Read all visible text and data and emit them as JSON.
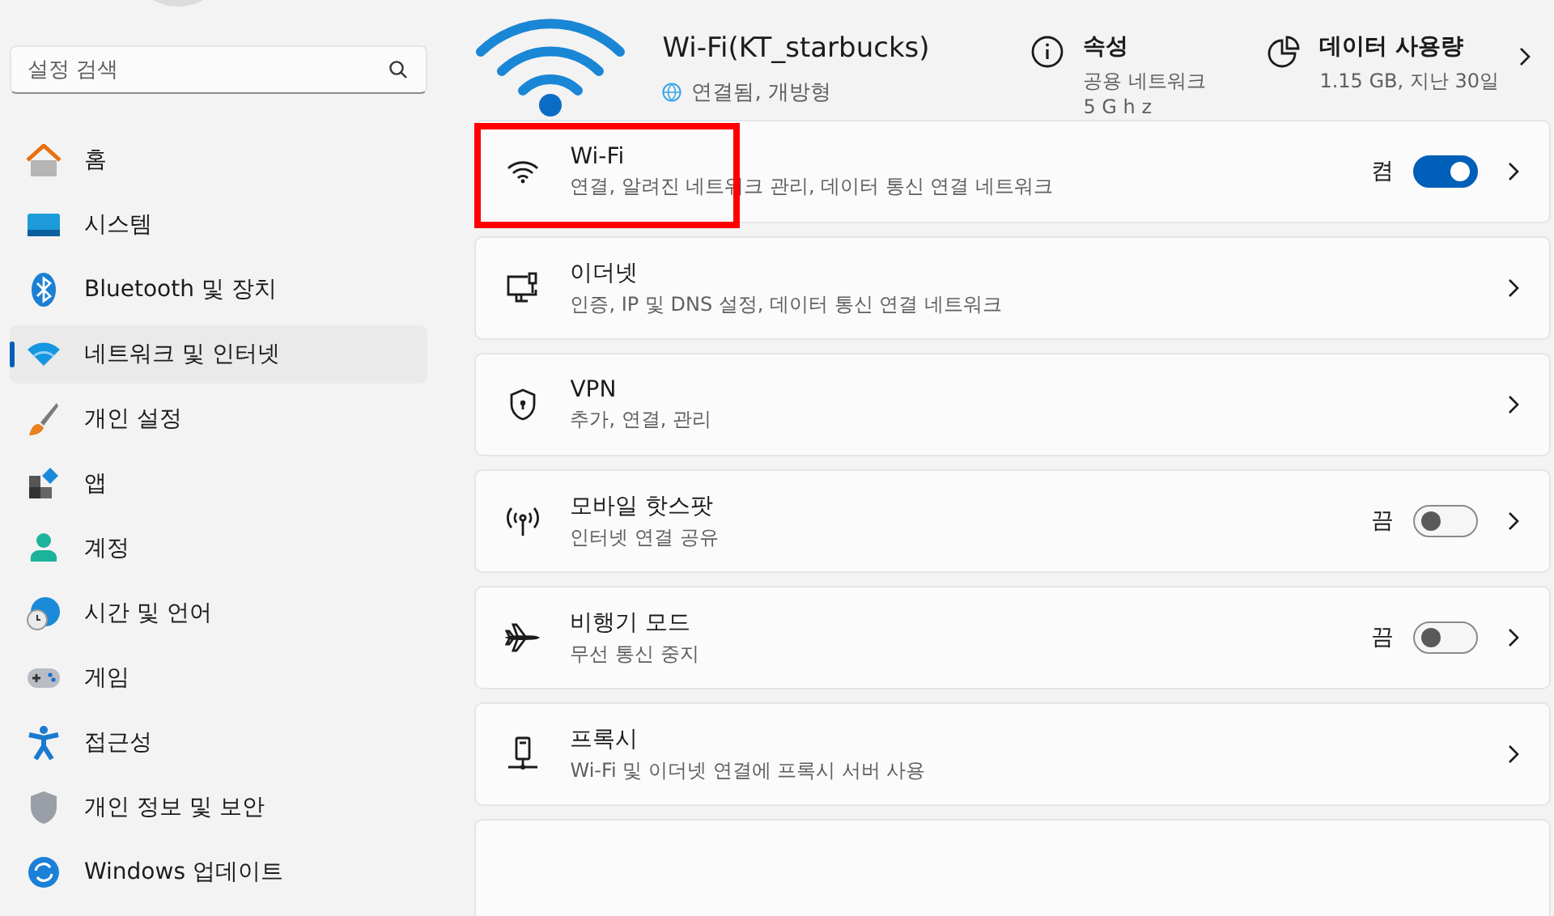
{
  "sidebar": {
    "search": {
      "placeholder": "설정 검색"
    },
    "items": [
      {
        "label": "홈",
        "selected": false
      },
      {
        "label": "시스템",
        "selected": false
      },
      {
        "label": "Bluetooth 및 장치",
        "selected": false
      },
      {
        "label": "네트워크 및 인터넷",
        "selected": true
      },
      {
        "label": "개인 설정",
        "selected": false
      },
      {
        "label": "앱",
        "selected": false
      },
      {
        "label": "계정",
        "selected": false
      },
      {
        "label": "시간 및 언어",
        "selected": false
      },
      {
        "label": "게임",
        "selected": false
      },
      {
        "label": "접근성",
        "selected": false
      },
      {
        "label": "개인 정보 및 보안",
        "selected": false
      },
      {
        "label": "Windows 업데이트",
        "selected": false
      }
    ]
  },
  "header": {
    "network_name": "Wi-Fi(KT_starbucks)",
    "status": "연결됨, 개방형",
    "properties": {
      "title": "속성",
      "lines": [
        "공용 네트워크",
        "5 G h z"
      ]
    },
    "data_usage": {
      "title": "데이터 사용량",
      "detail": "1.15 GB, 지난 30일"
    }
  },
  "settings": [
    {
      "kind": "toggle",
      "title": "Wi-Fi",
      "subtitle": "연결, 알려진 네트워크 관리, 데이터 통신 연결 네트워크",
      "state_label": "켬",
      "on": true,
      "highlighted": true
    },
    {
      "kind": "link",
      "title": "이더넷",
      "subtitle": "인증, IP 및 DNS 설정, 데이터 통신 연결 네트워크",
      "highlighted": false
    },
    {
      "kind": "link",
      "title": "VPN",
      "subtitle": "추가, 연결, 관리",
      "highlighted": false
    },
    {
      "kind": "toggle",
      "title": "모바일 핫스팟",
      "subtitle": "인터넷 연결 공유",
      "state_label": "끔",
      "on": false,
      "highlighted": false
    },
    {
      "kind": "toggle",
      "title": "비행기 모드",
      "subtitle": "무선 통신 중지",
      "state_label": "끔",
      "on": false,
      "highlighted": false
    },
    {
      "kind": "link",
      "title": "프록시",
      "subtitle": "Wi-Fi 및 이더넷 연결에 프록시 서버 사용",
      "highlighted": false
    },
    {
      "kind": "empty"
    }
  ]
}
